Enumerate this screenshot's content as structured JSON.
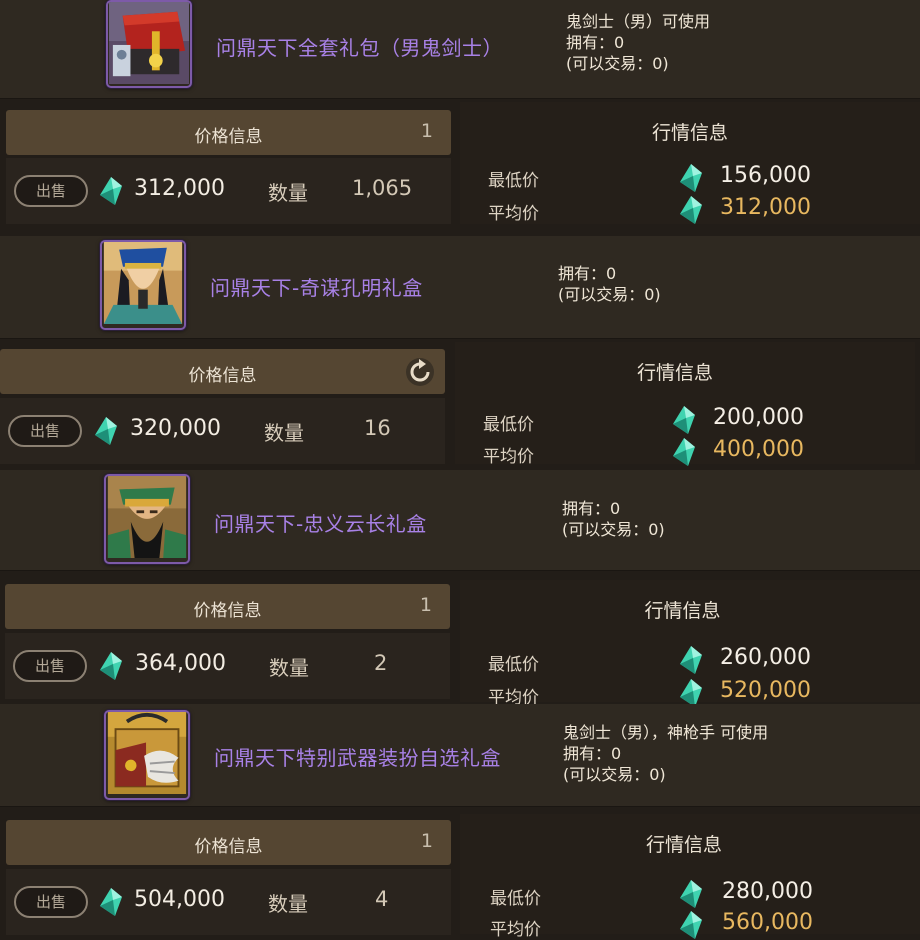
{
  "common": {
    "price_info_label": "价格信息",
    "market_info_label": "行情信息",
    "sell_label": "出售",
    "quantity_label": "数量",
    "min_price_label": "最低价",
    "avg_price_label": "平均价",
    "gem_color": "#3fd3b0",
    "name_color": "#a881e6",
    "avg_price_color": "#e8b860"
  },
  "listings": [
    {
      "name": "问鼎天下全套礼包（男鬼剑士）",
      "usable_by": "鬼剑士（男）可使用",
      "owned": "拥有：0",
      "tradable": "(可以交易：0)",
      "icon": "gift-box-icon",
      "bar_count": "1",
      "sell_price": "312,000",
      "quantity": "1,065",
      "min_price": "156,000",
      "avg_price": "312,000"
    },
    {
      "name": "问鼎天下-奇谋孔明礼盒",
      "usable_by": "",
      "owned": "拥有：0",
      "tradable": "(可以交易：0)",
      "icon": "kongming-portrait-icon",
      "bar_count": "",
      "sell_price": "320,000",
      "quantity": "16",
      "min_price": "200,000",
      "avg_price": "400,000"
    },
    {
      "name": "问鼎天下-忠义云长礼盒",
      "usable_by": "",
      "owned": "拥有：0",
      "tradable": "(可以交易：0)",
      "icon": "yunchang-portrait-icon",
      "bar_count": "1",
      "sell_price": "364,000",
      "quantity": "2",
      "min_price": "260,000",
      "avg_price": "520,000"
    },
    {
      "name": "问鼎天下特别武器装扮自选礼盒",
      "usable_by": "鬼剑士（男），神枪手 可使用",
      "owned": "拥有：0",
      "tradable": "(可以交易：0)",
      "icon": "weapon-box-icon",
      "bar_count": "1",
      "sell_price": "504,000",
      "quantity": "4",
      "min_price": "280,000",
      "avg_price": "560,000"
    }
  ]
}
